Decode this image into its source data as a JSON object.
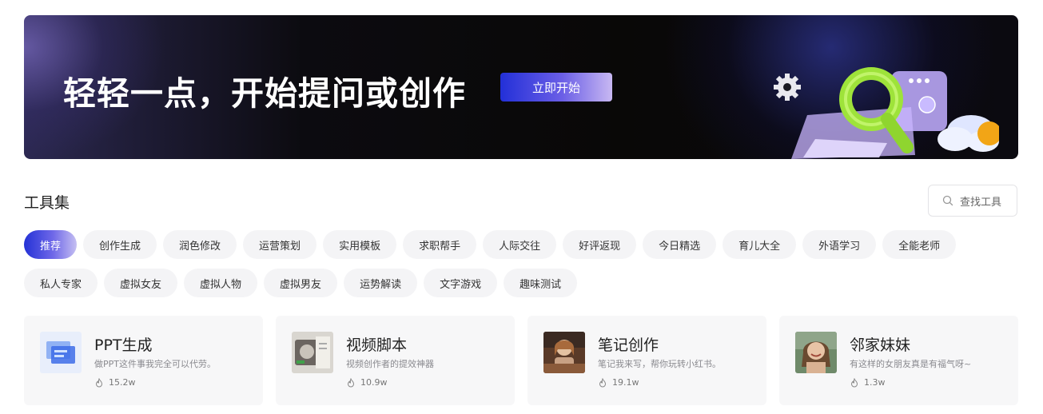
{
  "banner": {
    "title": "轻轻一点，开始提问或创作",
    "button_label": "立即开始"
  },
  "section": {
    "title": "工具集",
    "search_label": "查找工具"
  },
  "categories": [
    {
      "label": "推荐",
      "active": true
    },
    {
      "label": "创作生成"
    },
    {
      "label": "润色修改"
    },
    {
      "label": "运营策划"
    },
    {
      "label": "实用模板"
    },
    {
      "label": "求职帮手"
    },
    {
      "label": "人际交往"
    },
    {
      "label": "好评返现"
    },
    {
      "label": "今日精选"
    },
    {
      "label": "育儿大全"
    },
    {
      "label": "外语学习"
    },
    {
      "label": "全能老师"
    },
    {
      "label": "私人专家"
    },
    {
      "label": "虚拟女友"
    },
    {
      "label": "虚拟人物"
    },
    {
      "label": "虚拟男友"
    },
    {
      "label": "运势解读"
    },
    {
      "label": "文字游戏"
    },
    {
      "label": "趣味测试"
    }
  ],
  "cards": [
    {
      "title": "PPT生成",
      "desc": "做PPT这件事我完全可以代劳。",
      "count": "15.2w",
      "thumb": "ppt-thumbnail"
    },
    {
      "title": "视频脚本",
      "desc": "视频创作者的提效神器",
      "count": "10.9w",
      "thumb": "video-thumbnail"
    },
    {
      "title": "笔记创作",
      "desc": "笔记我来写，帮你玩转小红书。",
      "count": "19.1w",
      "thumb": "notes-thumbnail"
    },
    {
      "title": "邻家妹妹",
      "desc": "有这样的女朋友真是有福气呀~",
      "count": "1.3w",
      "thumb": "girl-thumbnail"
    }
  ],
  "colors": {
    "accent_start": "#2432d6",
    "accent_end": "#c5bff2",
    "chip_bg": "#f4f4f6",
    "card_bg": "#f7f7f8"
  }
}
